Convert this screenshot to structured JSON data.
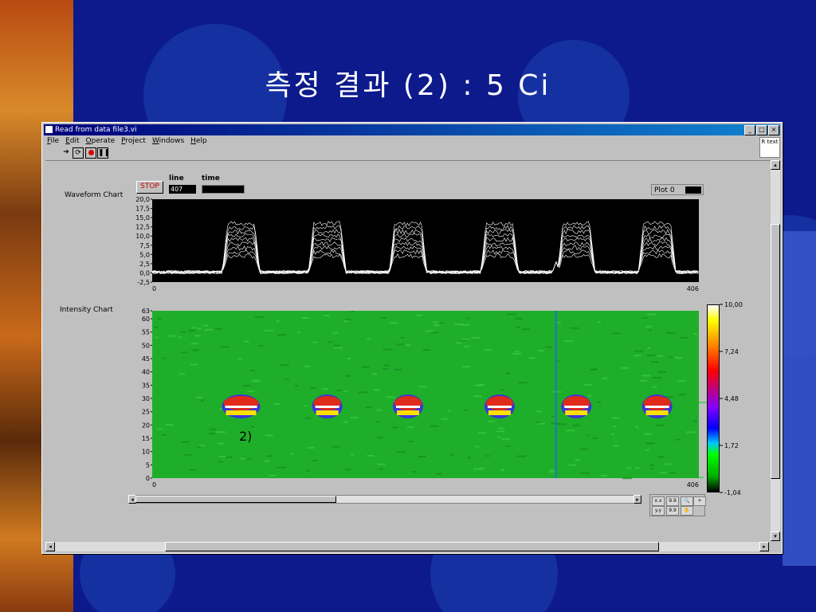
{
  "slide": {
    "title": "측정 결과 (2) : 5  Ci"
  },
  "window": {
    "title": "Read from data file3.vi",
    "min_label": "_",
    "max_label": "□",
    "close_label": "×",
    "menu": [
      "File",
      "Edit",
      "Operate",
      "Project",
      "Windows",
      "Help"
    ],
    "context_help": "R text"
  },
  "panel": {
    "stop_label": "STOP",
    "line_label": "line",
    "line_value": "407",
    "time_label": "time",
    "time_value": "",
    "waveform_label": "Waveform Chart",
    "intensity_label": "Intensity Chart",
    "plot_legend": "Plot 0"
  },
  "annotation": "2)",
  "colors": {
    "slide_bg": "#0d1a8c",
    "chart_bg": "#000000",
    "trace": "#ffffff",
    "intensity_bg": "#1fae2a"
  },
  "chart_data": [
    {
      "type": "line",
      "title": "Waveform Chart",
      "xlim": [
        0,
        406
      ],
      "ylim": [
        -2.5,
        20.0
      ],
      "yticks": [
        "20,0",
        "17,5",
        "15,0",
        "12,5",
        "10,0",
        "7,5",
        "5,0",
        "2,5",
        "0,0",
        "-2,5"
      ],
      "xticks": [
        "0",
        "406"
      ],
      "series": [
        {
          "name": "Plot 0",
          "pulses_x_centers": [
            66,
            130,
            190,
            258,
            315,
            375
          ],
          "pulse_peak": 14.5,
          "baseline": 0.2
        }
      ]
    },
    {
      "type": "heatmap",
      "title": "Intensity Chart",
      "xlim": [
        0,
        406
      ],
      "ylim": [
        0,
        63
      ],
      "yticks": [
        "63",
        "60",
        "55",
        "50",
        "45",
        "40",
        "35",
        "30",
        "25",
        "20",
        "15",
        "10",
        "5",
        "0"
      ],
      "xticks": [
        "0",
        "406"
      ],
      "spots_x_centers": [
        66,
        130,
        190,
        258,
        315,
        375
      ],
      "spot_y_center": 27,
      "colorbar": {
        "ticks": [
          "10,00",
          "7,24",
          "4,48",
          "1,72",
          "-1,04"
        ],
        "min": -1.04,
        "max": 10.0
      }
    }
  ]
}
